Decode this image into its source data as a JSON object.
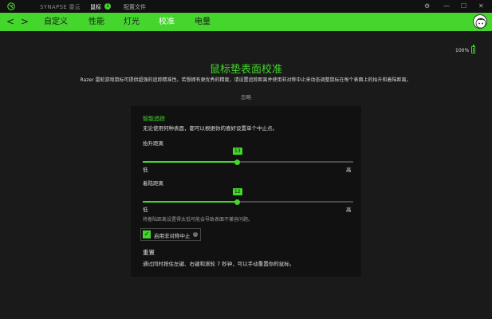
{
  "titlebar": {
    "app_name": "SYNAPSE 雷云",
    "mouse_label": "鼠标",
    "mouse_badge": "1",
    "profiles_label": "配置文件",
    "settings_glyph": "⚙",
    "minimize_glyph": "—",
    "maximize_glyph": "☐",
    "close_glyph": "✕"
  },
  "nav": {
    "back": "<",
    "forward": ">",
    "tabs": [
      "自定义",
      "性能",
      "灯光",
      "校准",
      "电量"
    ],
    "active_tab": "校准"
  },
  "battery": {
    "text": "100%",
    "level": 1.0
  },
  "page": {
    "title": "鼠标垫表面校准",
    "description": "Razer 雷蛇游戏鼠标可提供超强的追踪精准性。若想拥有更优秀的精度，请设置追踪距离并使用非对称中止来动态调整鼠标在每个表面上的抬升和着陆距离。",
    "ignore_link": "忽略"
  },
  "smart_tracking": {
    "heading": "智能追踪",
    "subtitle": "无论使用何种表面，都可以根据你的喜好设置单个中止点。",
    "lift": {
      "label": "抬升距离",
      "value": 13,
      "fraction": 0.45,
      "low": "低",
      "high": "高"
    },
    "landing": {
      "label": "着陆距离",
      "value": 12,
      "fraction": 0.45,
      "low": "低",
      "high": "高"
    },
    "warning": "将着陆距离设置得太低可能会导致表面不兼容问题。",
    "asymmetric": {
      "label": "启用非对称中止",
      "checked": true,
      "check_glyph": "✓",
      "help_glyph": "?"
    }
  },
  "reset": {
    "heading": "重置",
    "text": "通过同时按住左键、右键和滚轮 7 秒钟，可以手动重置你的鼠标。"
  },
  "colors": {
    "accent": "#44d62c",
    "background": "#1a1a1a",
    "card": "#111111"
  }
}
